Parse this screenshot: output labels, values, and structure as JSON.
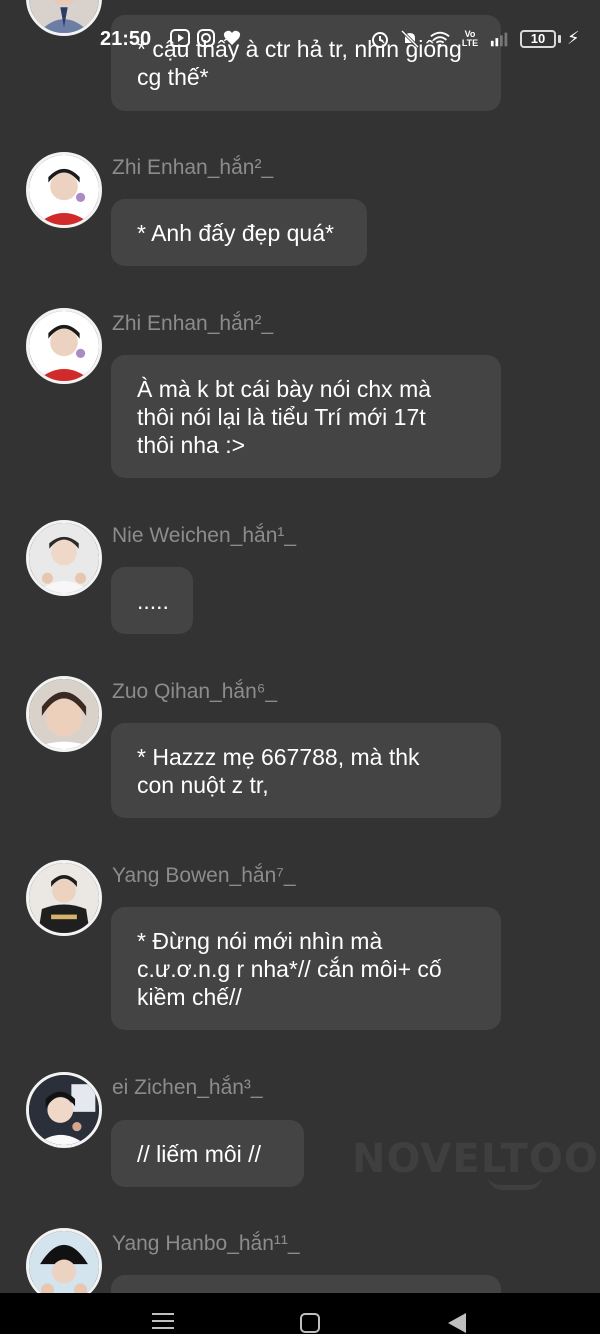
{
  "status_bar": {
    "time": "21:50",
    "battery": "10",
    "left_icons": [
      "video-app-icon",
      "instagram-icon",
      "heart-icon"
    ],
    "right_icons": [
      "alarm-icon",
      "mute-icon",
      "wifi-icon",
      "volte-icon",
      "signal-icon"
    ]
  },
  "messages": [
    {
      "sender": "",
      "text": "* cậu thấy à ctr hả tr, nhìn giống\ncg thế*"
    },
    {
      "sender": "Zhi Enhan_hắn²_",
      "text": "* Anh đấy đẹp quá*"
    },
    {
      "sender": "Zhi Enhan_hắn²_",
      "text": "À mà k bt cái bày nói chx mà\nthôi nói lại là tiểu Trí mới 17t\nthôi nha :>"
    },
    {
      "sender": "Nie Weichen_hắn¹_",
      "text": "....."
    },
    {
      "sender": "Zuo Qihan_hắn⁶_",
      "text": "* Hazzz mẹ 667788, mà thk\ncon nuột z tr,"
    },
    {
      "sender": "Yang Bowen_hắn⁷_",
      "text": "* Đừng nói mới nhìn mà\nc.ư.ơ.n.g r nha*// cắn môi+ cố\nkiềm chế//"
    },
    {
      "sender": "ei Zichen_hắn³_",
      "text": "// liếm môi //"
    },
    {
      "sender": "Yang Hanbo_hắn¹¹_",
      "text": ""
    }
  ],
  "watermark": "NOVELTOON",
  "nav": [
    "menu-icon",
    "home-icon",
    "back-icon"
  ],
  "colors": {
    "background": "#333333",
    "bubble": "#444444",
    "sender_text": "#8c8c8c",
    "message_text": "#ffffff"
  }
}
